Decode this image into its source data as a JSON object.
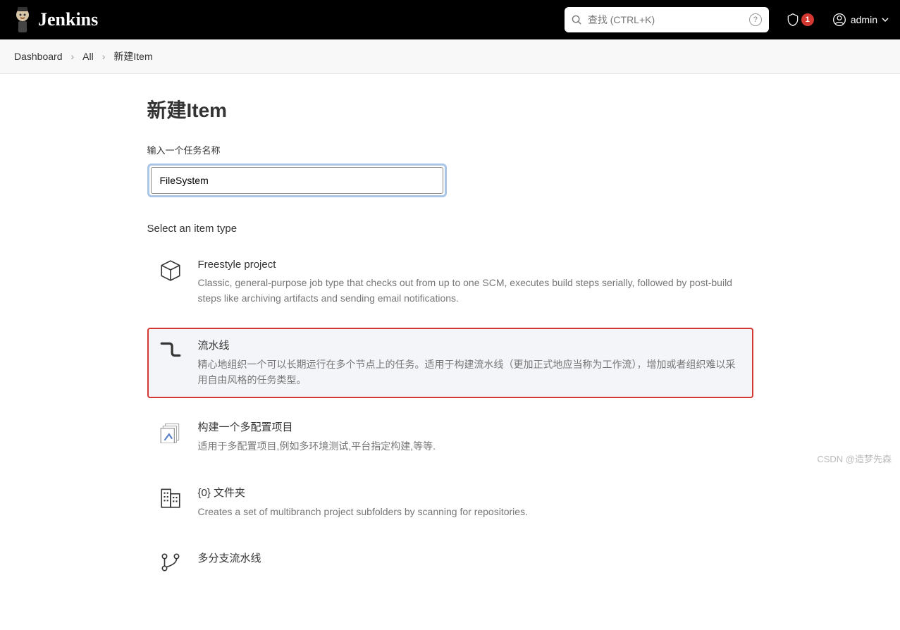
{
  "header": {
    "brand": "Jenkins",
    "search_placeholder": "查找 (CTRL+K)",
    "alert_count": "1",
    "user": "admin"
  },
  "breadcrumb": {
    "items": [
      "Dashboard",
      "All",
      "新建Item"
    ]
  },
  "page": {
    "title": "新建Item",
    "name_label": "输入一个任务名称",
    "name_value": "FileSystem",
    "section_label": "Select an item type"
  },
  "item_types": [
    {
      "title": "Freestyle project",
      "desc": "Classic, general-purpose job type that checks out from up to one SCM, executes build steps serially, followed by post-build steps like archiving artifacts and sending email notifications."
    },
    {
      "title": "流水线",
      "desc": "精心地组织一个可以长期运行在多个节点上的任务。适用于构建流水线（更加正式地应当称为工作流），增加或者组织难以采用自由风格的任务类型。"
    },
    {
      "title": "构建一个多配置项目",
      "desc": "适用于多配置项目,例如多环境测试,平台指定构建,等等."
    },
    {
      "title": "{0} 文件夹",
      "desc": "Creates a set of multibranch project subfolders by scanning for repositories."
    },
    {
      "title": "多分支流水线",
      "desc": ""
    }
  ],
  "watermark": "CSDN @造梦先森"
}
